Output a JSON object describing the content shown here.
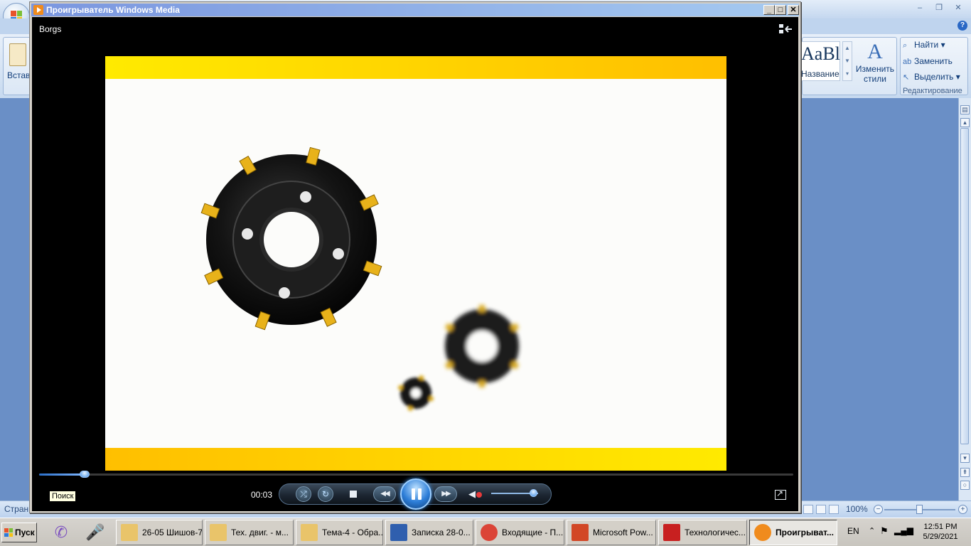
{
  "word": {
    "paste_label": "Встав",
    "style_preview": "AaBl",
    "style_name": "Название",
    "change_styles_line1": "Изменить",
    "change_styles_line2": "стили",
    "find": "Найти",
    "replace": "Заменить",
    "select": "Выделить",
    "editing_group": "Редактирование",
    "status_page": "Стран",
    "zoom": "100%"
  },
  "wmp": {
    "window_title": "Проигрыватель Windows Media",
    "media_title": "Borgs",
    "tooltip": "Поиск",
    "time": "00:03",
    "seek_progress": 0.06,
    "volume_level": 0.9,
    "state": "playing",
    "video": {
      "bar_color_light": "#ffea00",
      "bar_color_dark": "#ffbf00",
      "background": "#fcfcfa",
      "subject": "milling-cutters"
    }
  },
  "taskbar": {
    "start_label": "Пуск",
    "quick_launch": [
      "viber-icon",
      "microphone-icon"
    ],
    "tasks": [
      {
        "label": "26-05 Шишов-7",
        "icon": "folder-icon"
      },
      {
        "label": "Тех. двиг. - м...",
        "icon": "folder-icon"
      },
      {
        "label": "Тема-4 - Обра...",
        "icon": "folder-icon"
      },
      {
        "label": "Записка 28-0...",
        "icon": "word-icon"
      },
      {
        "label": "Входящие - П...",
        "icon": "chrome-icon"
      },
      {
        "label": "Microsoft Pow...",
        "icon": "powerpoint-icon"
      },
      {
        "label": "Технологичес...",
        "icon": "pdf-icon"
      },
      {
        "label": "Проигрыват...",
        "icon": "wmp-icon",
        "active": true
      }
    ],
    "lang": "EN",
    "time": "12:51 PM",
    "date": "5/29/2021"
  }
}
